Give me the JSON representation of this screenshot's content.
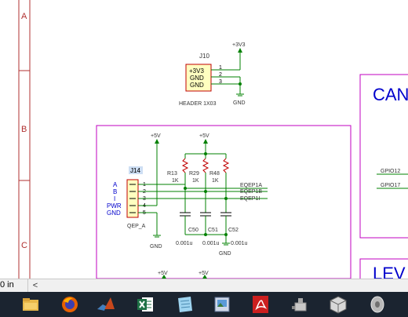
{
  "schematic": {
    "zone_labels": [
      "A",
      "B",
      "C"
    ],
    "j10": {
      "ref": "J10",
      "pins": [
        "+3V3",
        "GND",
        "GND"
      ],
      "pin_numbers": [
        "1",
        "2",
        "3"
      ],
      "value": "HEADER 1X03",
      "power": "+3V3",
      "ground": "GND"
    },
    "j14": {
      "ref": "J14",
      "pin_numbers": [
        "1",
        "2",
        "3",
        "4",
        "5"
      ],
      "signals": [
        "A",
        "B",
        "I",
        "PWR",
        "GND"
      ],
      "value": "QEP_A",
      "ground": "GND"
    },
    "power_5v": "+5V",
    "resistors": [
      {
        "ref": "R13",
        "value": "1K"
      },
      {
        "ref": "R29",
        "value": "1K"
      },
      {
        "ref": "R48",
        "value": "1K"
      }
    ],
    "nets": [
      "EQEP1A",
      "EQEP1B",
      "EQEP1I"
    ],
    "capacitors": [
      {
        "ref": "C50",
        "value": "0.001u"
      },
      {
        "ref": "C51",
        "value": "0.001u"
      },
      {
        "ref": "C52",
        "value": "0.001u"
      }
    ],
    "cap_ground": "GND",
    "can_box": {
      "title": "CAN",
      "gpio_a": "GPIO12",
      "gpio_b": "GPIO17"
    },
    "lev_box": {
      "title": "LEV"
    },
    "bottom_power": [
      "+5V",
      "+5V"
    ]
  },
  "status_bar": {
    "zoom_text": "0 in",
    "scroll_left": "<"
  },
  "taskbar": {
    "icons": [
      "file-explorer-icon",
      "firefox-icon",
      "matlab-icon",
      "excel-icon",
      "notepad-icon",
      "image-viewer-icon",
      "pdf-reader-icon",
      "usb-device-icon",
      "3d-box-icon",
      "disc-icon"
    ]
  },
  "colors": {
    "wire": "#008000",
    "zone_border": "#b03030",
    "sheet_box": "#c000c0",
    "title_blue": "#0000cc",
    "label_blue": "#0000cc",
    "body_fill": "#ffffc0",
    "body_border": "#c00000",
    "taskbar": "#1b2430"
  }
}
